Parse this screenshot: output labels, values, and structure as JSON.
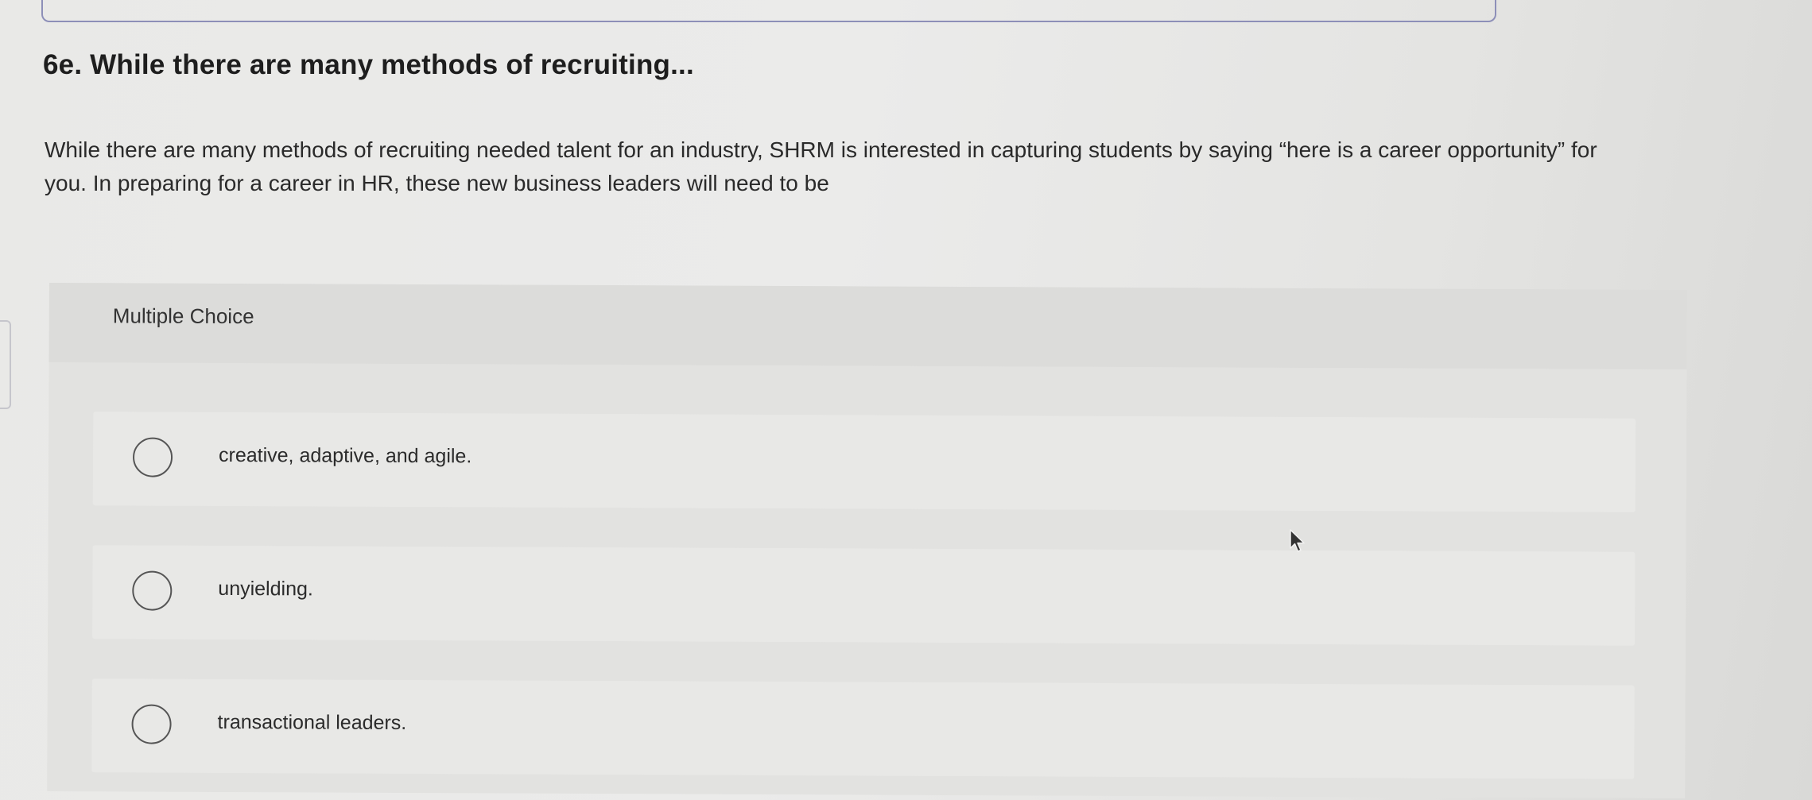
{
  "question": {
    "title": "6e. While there are many methods of recruiting...",
    "prompt": "While there are many methods of recruiting needed talent for an industry, SHRM is interested in capturing students by saying “here is a career opportunity” for you. In preparing for a career in HR, these new business leaders will need to be"
  },
  "choices": {
    "type_label": "Multiple Choice",
    "options": [
      {
        "label": "creative, adaptive, and agile.",
        "selected": false
      },
      {
        "label": "unyielding.",
        "selected": false
      },
      {
        "label": "transactional leaders.",
        "selected": false
      }
    ]
  },
  "icons": {
    "radio": "radio-button-icon",
    "cursor": "mouse-pointer-icon"
  },
  "colors": {
    "frame_border": "#8d8fb8",
    "panel_background": "#e2e2e0",
    "text": "#222222"
  }
}
